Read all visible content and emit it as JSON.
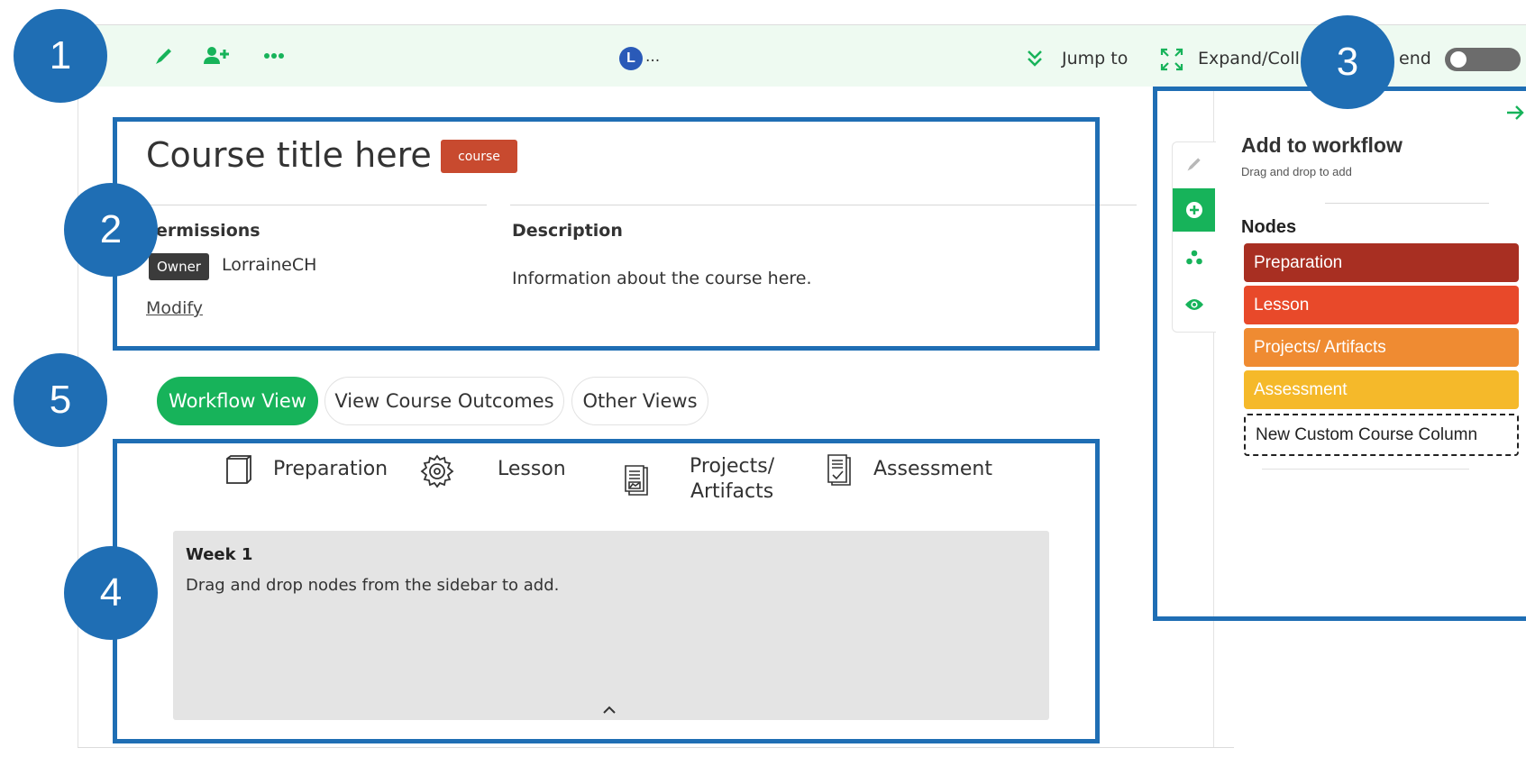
{
  "toolbar": {
    "icons": [
      "pencil-icon",
      "add-user-icon",
      "more-icon"
    ],
    "user_initial": "L",
    "user_more": "...",
    "jump_to": "Jump to",
    "expand_collapse": "Expand/Coll",
    "legend_partial": "end",
    "accent": "#17b35a"
  },
  "course": {
    "title": "Course title here",
    "tag": "course",
    "permissions_label": "ermissions",
    "owner_tag": "Owner",
    "owner_name": "LorraineCH",
    "modify_label": "Modify",
    "description_label": "Description",
    "description_text": "Information about the course here."
  },
  "view_tabs": [
    "Workflow View",
    "View Course Outcomes",
    "Other Views"
  ],
  "columns": [
    {
      "label": "Preparation",
      "icon": "book-icon"
    },
    {
      "label": "Lesson",
      "icon": "gear-icon"
    },
    {
      "label_line1": "Projects/",
      "label_line2": "Artifacts",
      "icon": "chart-document-icon"
    },
    {
      "label": "Assessment",
      "icon": "checklist-icon"
    }
  ],
  "week": {
    "title": "Week 1",
    "hint": "Drag and drop nodes from the sidebar to add."
  },
  "sidebar": {
    "title": "Add to workflow",
    "subtitle": "Drag and drop to add",
    "nodes_label": "Nodes",
    "nodes": [
      {
        "label": "Preparation",
        "color": "#a82f22"
      },
      {
        "label": "Lesson",
        "color": "#e8492a"
      },
      {
        "label": "Projects/ Artifacts",
        "color": "#ef8b32"
      },
      {
        "label": "Assessment",
        "color": "#f5b92a"
      },
      {
        "label": "New Custom Course Column",
        "color": "#ffffff"
      }
    ]
  },
  "badges": [
    "1",
    "2",
    "3",
    "4",
    "5"
  ],
  "highlight_color": "#1f6eb4"
}
